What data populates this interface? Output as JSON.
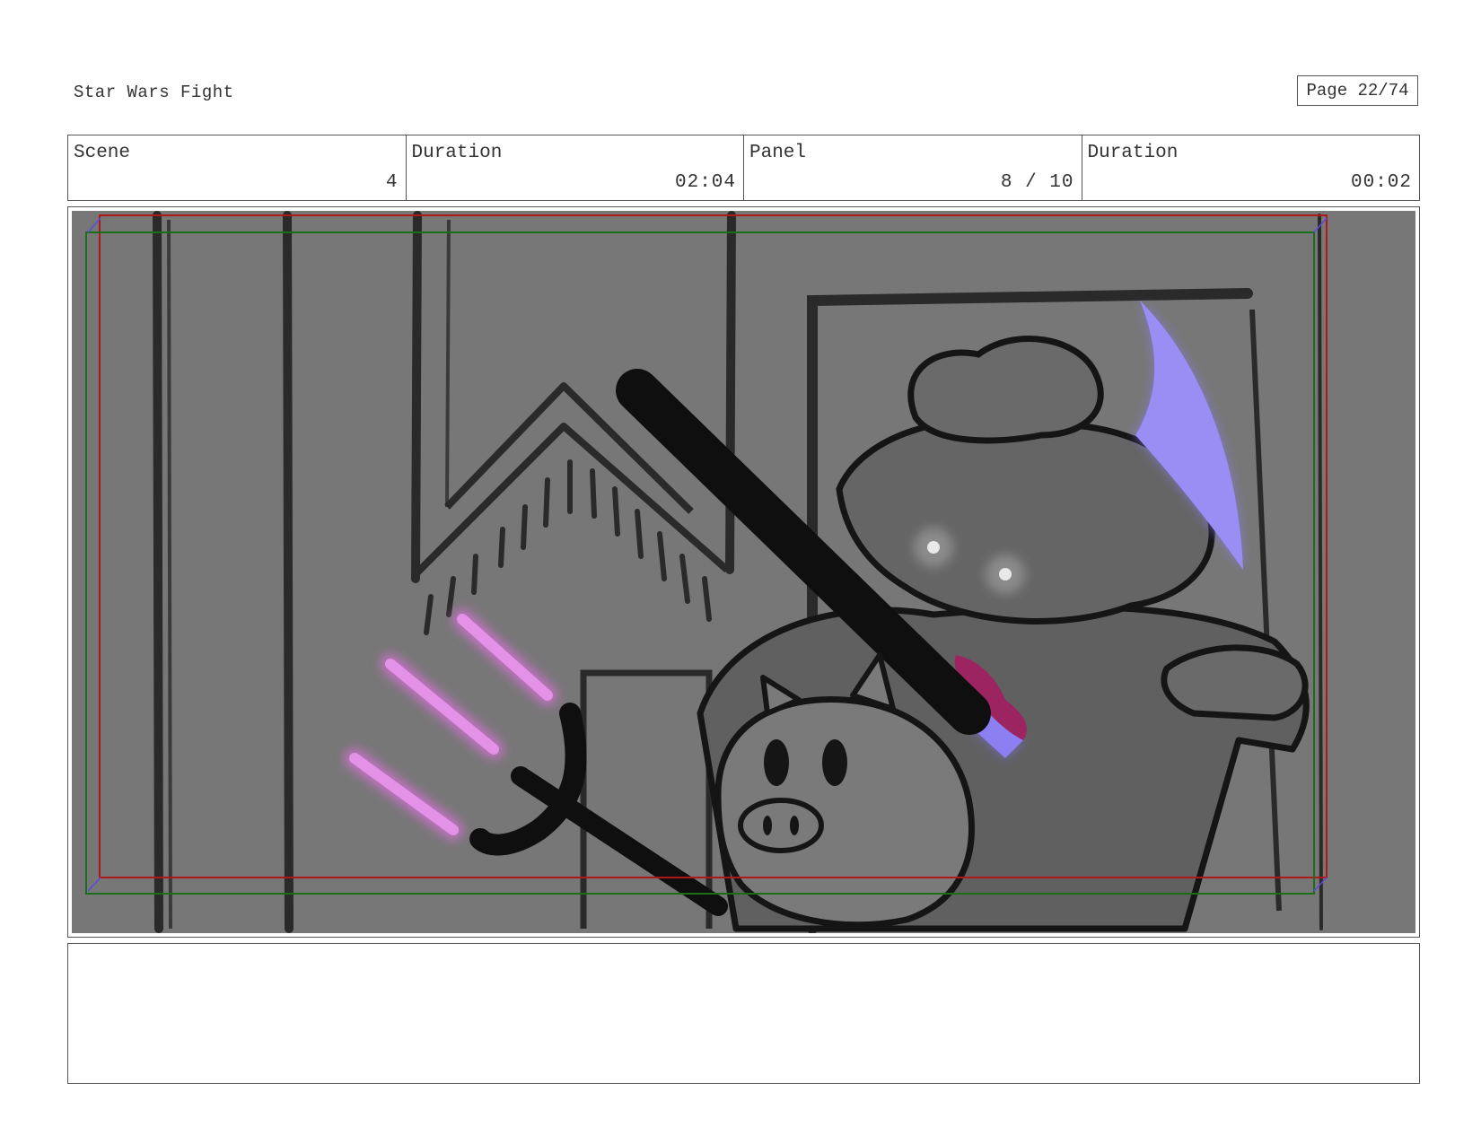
{
  "header": {
    "title": "Star Wars Fight",
    "page": "Page 22/74"
  },
  "info": {
    "scene_label": "Scene",
    "scene_value": "4",
    "scene_duration_label": "Duration",
    "scene_duration_value": "02:04",
    "panel_label": "Panel",
    "panel_value": "8 / 10",
    "panel_duration_label": "Duration",
    "panel_duration_value": "00:02"
  },
  "notes": {
    "text": ""
  },
  "colors": {
    "background_gray": "#777777",
    "pink_saber": "#e070e0",
    "blue_saber": "#8a7cf0",
    "safe_frame_red": "#b01818",
    "safe_frame_green": "#1a6e1a"
  }
}
